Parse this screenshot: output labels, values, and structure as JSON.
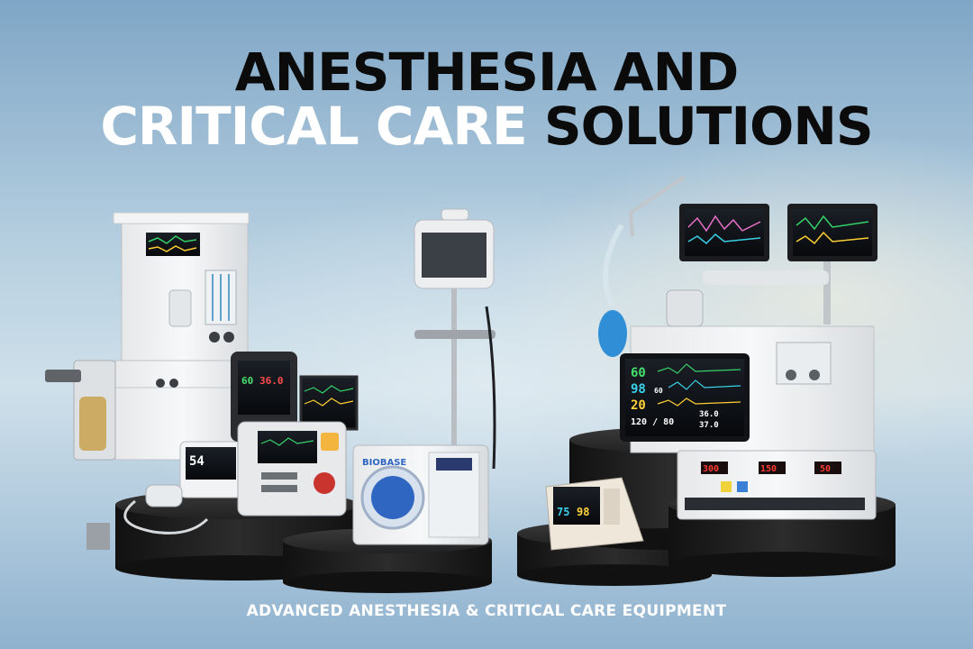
{
  "headline": {
    "line1": "ANESTHESIA AND",
    "line2_white": "CRITICAL CARE",
    "line2_black": "SOLUTIONS"
  },
  "footer": {
    "tagline": "ADVANCED ANESTHESIA & CRITICAL CARE EQUIPMENT"
  },
  "devices": {
    "autoclave_brand": "BIOBASE",
    "monitor_left_readings": [
      "54",
      "60",
      "36.0"
    ],
    "patient_monitor_readings": [
      "60",
      "98",
      "20",
      "120 / 80",
      "36.0",
      "37.0",
      "60"
    ],
    "small_monitor_readings": [
      "75",
      "98"
    ],
    "electrosurgical_readings": [
      "300",
      "150",
      "50"
    ]
  },
  "colors": {
    "headline_black": "#0b0b0b",
    "headline_white": "#ffffff",
    "pedestal": "#1f1f1f"
  }
}
